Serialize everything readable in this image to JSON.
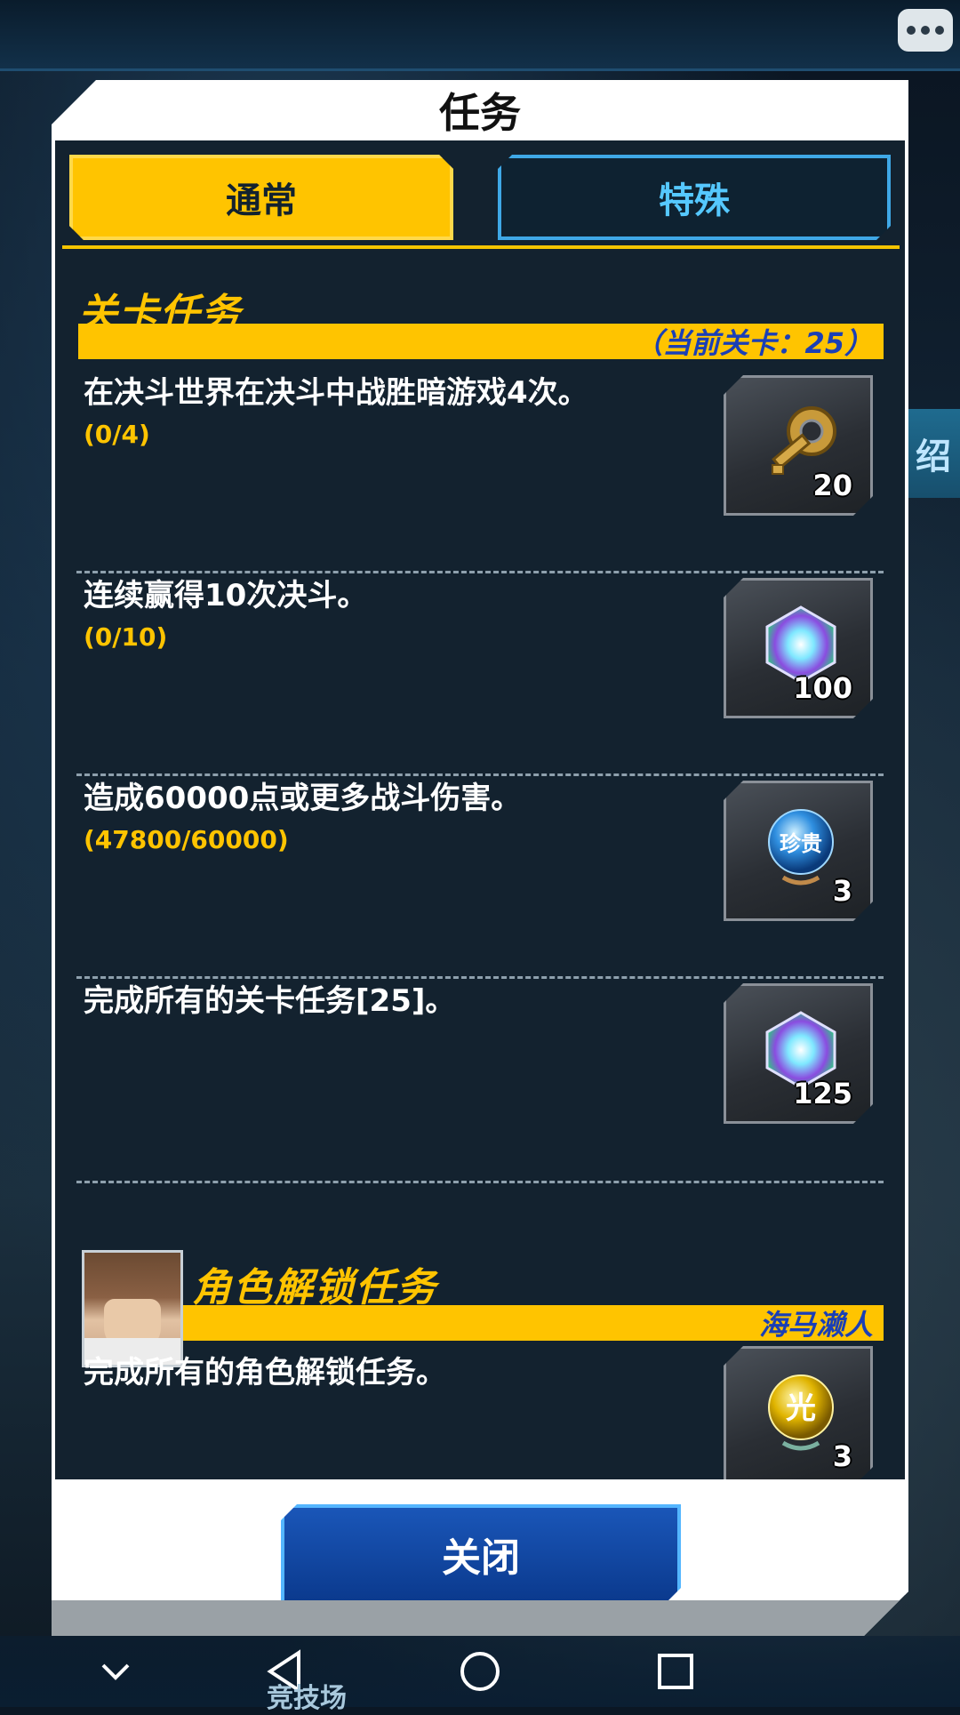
{
  "dialog": {
    "title": "任务",
    "tabs": [
      {
        "label": "通常",
        "active": true
      },
      {
        "label": "特殊",
        "active": false
      }
    ]
  },
  "stage_section": {
    "title": "关卡任务",
    "current_stage": "（当前关卡：25）"
  },
  "missions": [
    {
      "text": "在决斗世界在决斗中战胜暗游戏4次。",
      "progress": "(0/4)",
      "reward_icon": "key-icon",
      "reward_count": "20"
    },
    {
      "text": "连续赢得10次决斗。",
      "progress": "(0/10)",
      "reward_icon": "gem-icon",
      "reward_count": "100"
    },
    {
      "text": "造成60000点或更多战斗伤害。",
      "progress": "(47800/60000)",
      "reward_icon": "precious-orb-icon",
      "reward_count": "3"
    },
    {
      "text": "完成所有的关卡任务[25]。",
      "progress": "",
      "reward_icon": "gem-icon",
      "reward_count": "125"
    }
  ],
  "character_section": {
    "title": "角色解锁任务",
    "character_name": "海马濑人",
    "mission": {
      "text": "完成所有的角色解锁任务。",
      "reward_icon": "light-orb-icon",
      "reward_count": "3",
      "orb_glyph": "光"
    }
  },
  "gem_orb_label": "珍贵",
  "close_button": "关闭",
  "side_tag": "绍",
  "background_nav_label": "竞技场",
  "colors": {
    "accent_yellow": "#ffc400",
    "panel_bg": "#13222f",
    "button_blue": "#0b3a8e",
    "link_blue": "#1a3fb6"
  }
}
